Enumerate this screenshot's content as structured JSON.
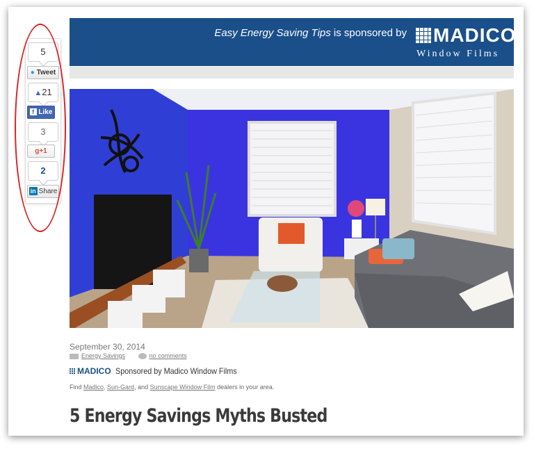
{
  "share": {
    "tweet_count": "5",
    "tweet_label": "Tweet",
    "like_count": "21",
    "like_label": "Like",
    "gplus_count": "3",
    "gplus_label": "+1",
    "linkedin_count": "2",
    "linkedin_label": "Share"
  },
  "banner": {
    "title_italic": "Easy Energy Saving Tips",
    "title_rest": " is sponsored by",
    "brand": "MADICO",
    "brand_sub": "Window Films",
    "bg_color": "#1a4f8a"
  },
  "post": {
    "date": "September 30, 2014",
    "category": "Energy Savings",
    "comments": "no comments",
    "sponsor_logo": "MADICO",
    "sponsor_text": "Sponsored by Madico Window Films",
    "find_prefix": "Find ",
    "find_link1": "Madico",
    "find_sep1": ", ",
    "find_link2": "Sun-Gard",
    "find_sep2": ", and ",
    "find_link3": "Sunscape Window Film",
    "find_suffix": " dealers in your area.",
    "title": "5 Energy Savings Myths Busted"
  },
  "icons": [
    "twitter-icon",
    "thumbs-up-icon",
    "facebook-icon",
    "google-plus-icon",
    "linkedin-icon",
    "folder-icon",
    "comment-icon"
  ]
}
